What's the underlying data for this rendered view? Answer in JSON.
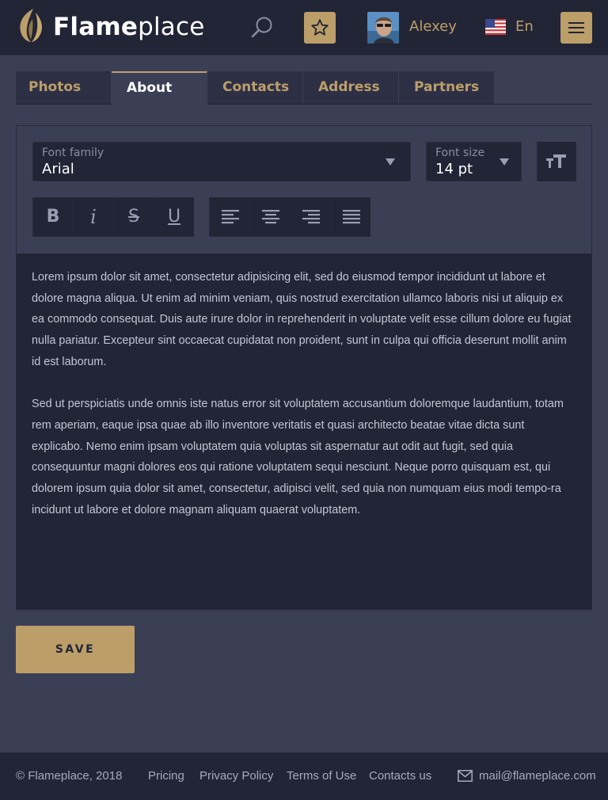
{
  "header": {
    "brand_bold": "Flame",
    "brand_light": "place",
    "user_name": "Alexey",
    "language": "En",
    "icons": [
      "flame-logo",
      "search-icon",
      "star-icon",
      "us-flag-icon",
      "hamburger-menu-icon"
    ]
  },
  "tabs": [
    {
      "label": "Photos",
      "active": false
    },
    {
      "label": "About",
      "active": true
    },
    {
      "label": "Contacts",
      "active": false
    },
    {
      "label": "Address",
      "active": false
    },
    {
      "label": "Partners",
      "active": false
    }
  ],
  "editor": {
    "font_family": {
      "label": "Font family",
      "value": "Arial"
    },
    "font_size": {
      "label": "Font size",
      "value": "14 pt"
    },
    "format_buttons": [
      "B",
      "i",
      "S",
      "U"
    ],
    "align_buttons": [
      "align-left",
      "align-center",
      "align-right",
      "align-justify"
    ],
    "paragraphs": [
      "Lorem ipsum dolor sit amet, consectetur adipisicing elit, sed do eiusmod tempor incididunt ut labore et dolore magna aliqua. Ut enim ad minim veniam, quis nostrud exercitation ullamco laboris nisi ut aliquip ex ea commodo consequat. Duis aute irure dolor in reprehenderit in voluptate velit esse cillum dolore eu fugiat nulla pariatur. Excepteur sint occaecat cupidatat non proident, sunt in culpa qui officia deserunt mollit anim id est laborum.",
      "Sed ut perspiciatis unde omnis iste natus error sit voluptatem accusantium doloremque laudantium, totam rem aperiam, eaque ipsa quae ab illo inventore veritatis et quasi architecto beatae vitae dicta sunt explicabo. Nemo enim ipsam voluptatem quia voluptas sit aspernatur aut odit aut fugit, sed quia consequuntur magni dolores eos qui ratione voluptatem sequi nesciunt. Neque porro quisquam est, qui dolorem ipsum quia dolor sit amet, consectetur, adipisci velit, sed quia non numquam eius modi tempo-ra incidunt ut labore et dolore magnam aliquam quaerat voluptatem."
    ]
  },
  "save_label": "SAVE",
  "footer": {
    "copyright": "© Flameplace, 2018",
    "links": [
      "Pricing",
      "Privacy Policy",
      "Terms of Use",
      "Contacts us"
    ],
    "email": "mail@flameplace.com"
  },
  "colors": {
    "accent": "#bc9e69",
    "header_bg": "#222536",
    "page_bg": "#3b3f56",
    "panel_bg": "#222536"
  }
}
